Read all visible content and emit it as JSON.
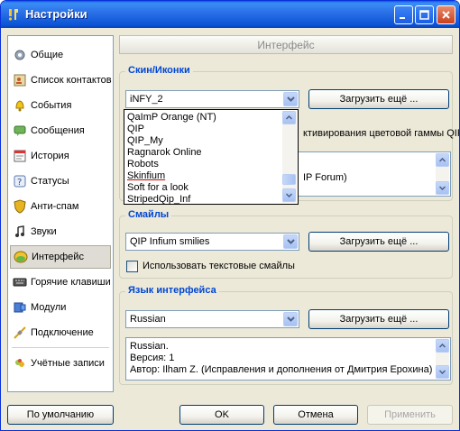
{
  "window": {
    "title": "Настройки"
  },
  "nav": {
    "items": [
      {
        "label": "Общие",
        "icon": "gear-icon"
      },
      {
        "label": "Список контактов",
        "icon": "contacts-icon"
      },
      {
        "label": "События",
        "icon": "bell-icon"
      },
      {
        "label": "Сообщения",
        "icon": "message-icon"
      },
      {
        "label": "История",
        "icon": "history-icon"
      },
      {
        "label": "Статусы",
        "icon": "status-icon"
      },
      {
        "label": "Анти-спам",
        "icon": "shield-icon"
      },
      {
        "label": "Звуки",
        "icon": "music-note-icon"
      },
      {
        "label": "Интерфейс",
        "icon": "interface-icon",
        "selected": true
      },
      {
        "label": "Горячие клавиши",
        "icon": "keyboard-icon"
      },
      {
        "label": "Модули",
        "icon": "plugin-icon"
      },
      {
        "label": "Подключение",
        "icon": "connection-icon"
      },
      {
        "label": "Учётные записи",
        "icon": "accounts-icon"
      }
    ]
  },
  "header": {
    "title": "Интерфейс"
  },
  "skin": {
    "group_title": "Скин/Иконки",
    "selected": "iNFY_2",
    "load_button": "Загрузить ещё ...",
    "partial_text": "ктивирования цветовой гаммы QIP",
    "info_partial": "IP Forum)",
    "dropdown_items": [
      "QaImP Orange (NT)",
      "QIP",
      "QIP_My",
      "Ragnarok Online",
      "Robots",
      "Skinfium",
      "Soft for a look",
      "StripedQip_Inf"
    ]
  },
  "smiles": {
    "group_title": "Смайлы",
    "selected": "QIP Infium smilies",
    "load_button": "Загрузить ещё ...",
    "checkbox_label": "Использовать текстовые смайлы",
    "checked": false
  },
  "language": {
    "group_title": "Язык интерфейса",
    "selected": "Russian",
    "load_button": "Загрузить ещё ...",
    "info_lines": [
      "Russian.",
      "Версия: 1",
      "Автор: Ilham Z. (Исправления и дополнения от Дмитрия Ерохина)"
    ]
  },
  "footer": {
    "defaults_button": "По умолчанию",
    "ok_button": "OK",
    "cancel_button": "Отмена",
    "apply_button": "Применить"
  },
  "colors": {
    "accent": "#0046d5",
    "titlebar": "#0a5fdb"
  }
}
